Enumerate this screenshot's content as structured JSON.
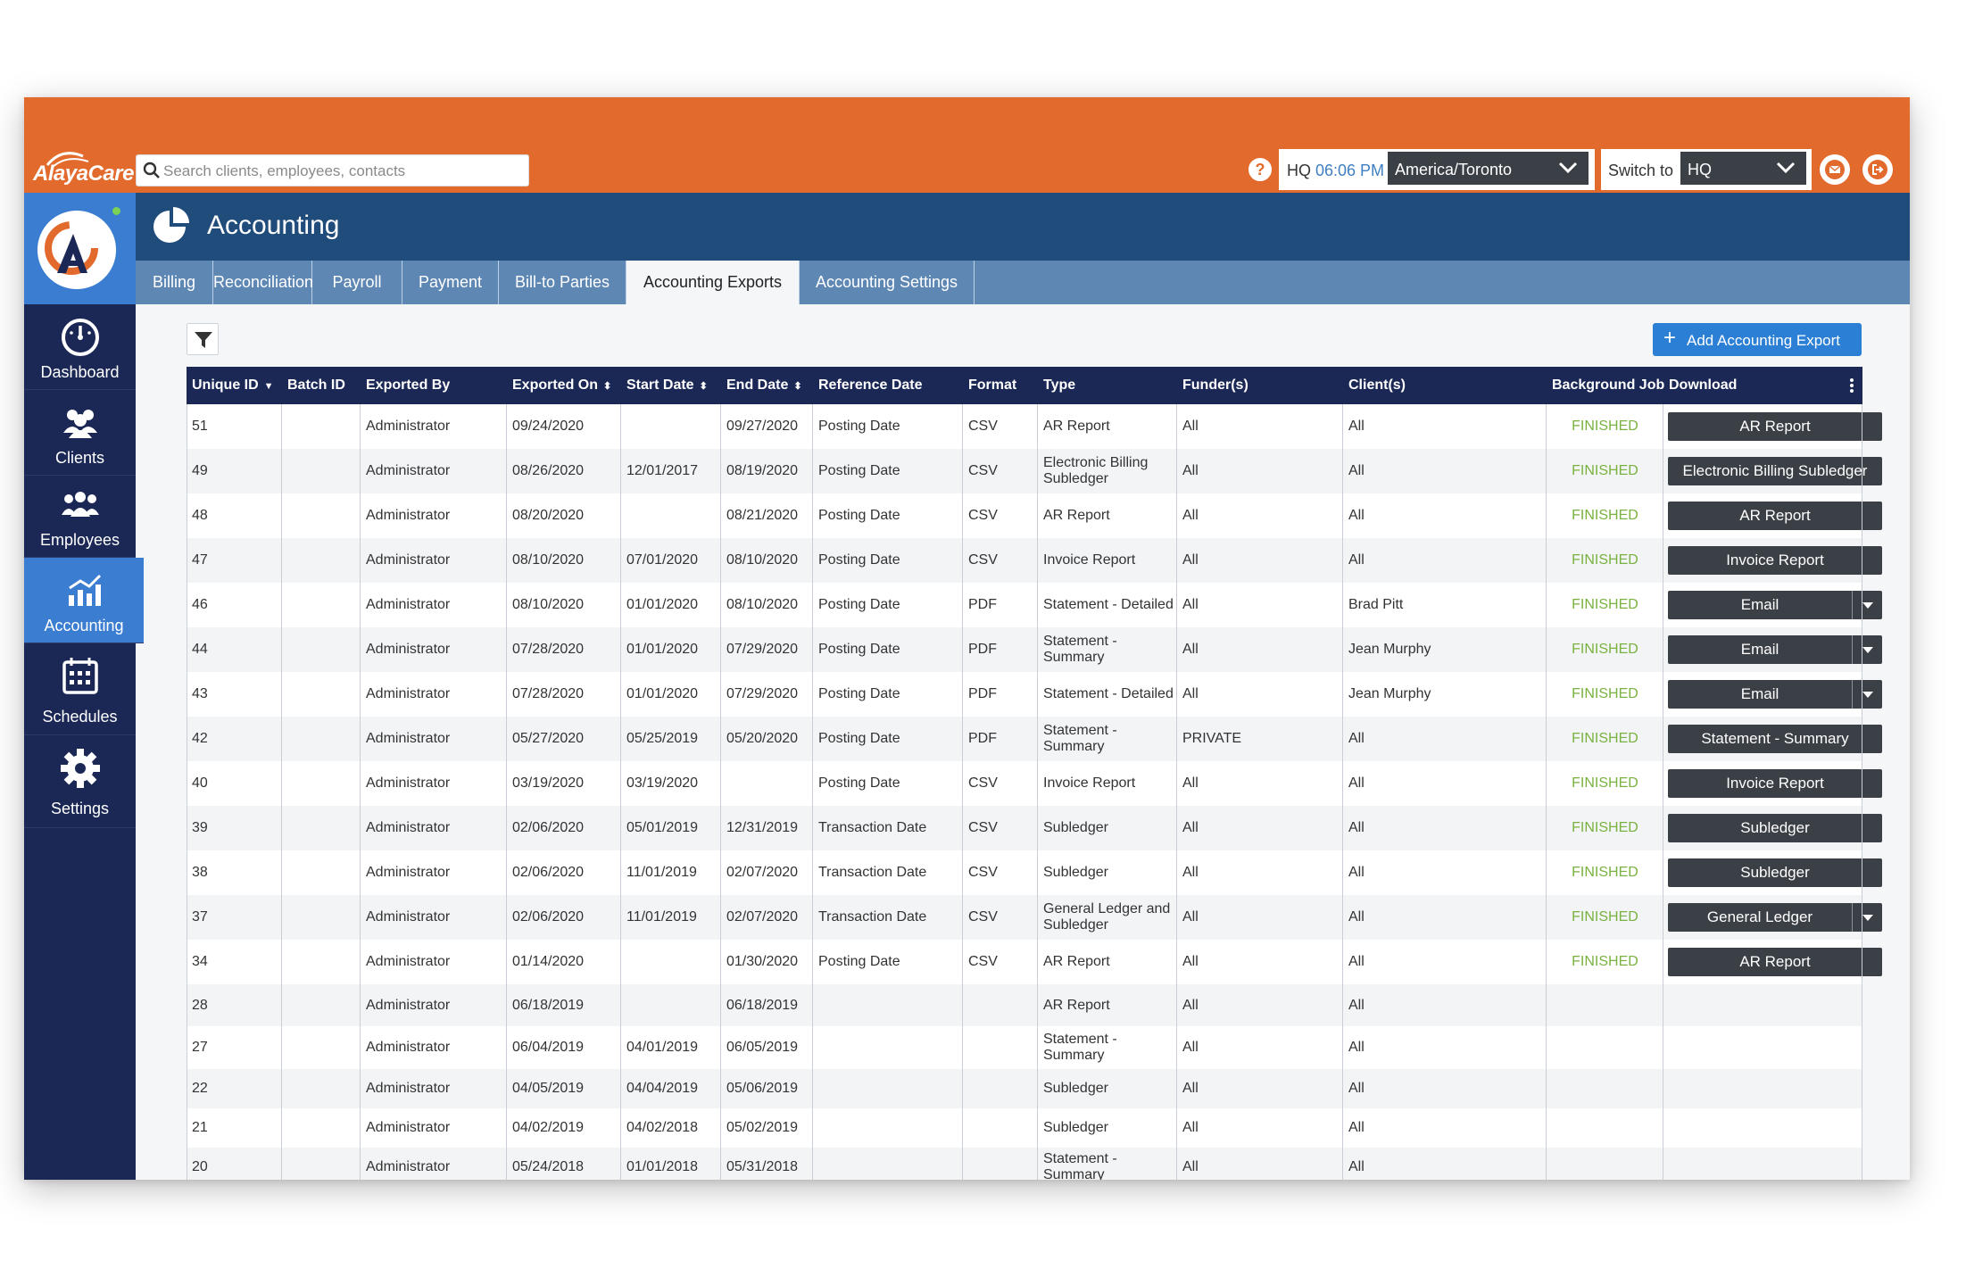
{
  "app": {
    "logo_text": "AlayaCare",
    "search_placeholder": "Search clients, employees, contacts"
  },
  "topbar": {
    "help_label": "?",
    "hq_label": "HQ",
    "time": "06:06 PM",
    "timezone": "America/Toronto",
    "switch_label": "Switch to",
    "switch_value": "HQ"
  },
  "sidebar": {
    "items": [
      {
        "label": "Dashboard",
        "icon": "gauge-icon"
      },
      {
        "label": "Clients",
        "icon": "clients-icon"
      },
      {
        "label": "Employees",
        "icon": "employees-icon"
      },
      {
        "label": "Accounting",
        "icon": "chart-icon",
        "active": true
      },
      {
        "label": "Schedules",
        "icon": "calendar-icon"
      },
      {
        "label": "Settings",
        "icon": "gear-icon"
      }
    ]
  },
  "header": {
    "title": "Accounting",
    "icon": "pie-chart-icon"
  },
  "tabs": [
    {
      "label": "Billing"
    },
    {
      "label": "Reconciliation"
    },
    {
      "label": "Payroll"
    },
    {
      "label": "Payment"
    },
    {
      "label": "Bill-to Parties"
    },
    {
      "label": "Accounting Exports",
      "active": true
    },
    {
      "label": "Accounting Settings"
    }
  ],
  "toolbar": {
    "add_label": "Add Accounting Export"
  },
  "table": {
    "columns": [
      {
        "label": "Unique ID",
        "sort": "▼"
      },
      {
        "label": "Batch ID"
      },
      {
        "label": "Exported By"
      },
      {
        "label": "Exported On",
        "sort": "⬍"
      },
      {
        "label": "Start Date",
        "sort": "⬍"
      },
      {
        "label": "End Date",
        "sort": "⬍"
      },
      {
        "label": "Reference Date"
      },
      {
        "label": "Format"
      },
      {
        "label": "Type"
      },
      {
        "label": "Funder(s)"
      },
      {
        "label": "Client(s)"
      },
      {
        "label": "Background Job"
      },
      {
        "label": "Download"
      }
    ],
    "rows": [
      {
        "id": "51",
        "batch": "",
        "by": "Administrator",
        "on": "09/24/2020",
        "start": "",
        "end": "09/27/2020",
        "ref": "Posting Date",
        "format": "CSV",
        "type": "AR Report",
        "funders": "All",
        "clients": "All",
        "status": "FINISHED",
        "download": "AR Report",
        "split": false
      },
      {
        "id": "49",
        "batch": "",
        "by": "Administrator",
        "on": "08/26/2020",
        "start": "12/01/2017",
        "end": "08/19/2020",
        "ref": "Posting Date",
        "format": "CSV",
        "type": "Electronic Billing Subledger",
        "funders": "All",
        "clients": "All",
        "status": "FINISHED",
        "download": "Electronic Billing Subledger",
        "split": false
      },
      {
        "id": "48",
        "batch": "",
        "by": "Administrator",
        "on": "08/20/2020",
        "start": "",
        "end": "08/21/2020",
        "ref": "Posting Date",
        "format": "CSV",
        "type": "AR Report",
        "funders": "All",
        "clients": "All",
        "status": "FINISHED",
        "download": "AR Report",
        "split": false
      },
      {
        "id": "47",
        "batch": "",
        "by": "Administrator",
        "on": "08/10/2020",
        "start": "07/01/2020",
        "end": "08/10/2020",
        "ref": "Posting Date",
        "format": "CSV",
        "type": "Invoice Report",
        "funders": "All",
        "clients": "All",
        "status": "FINISHED",
        "download": "Invoice Report",
        "split": false
      },
      {
        "id": "46",
        "batch": "",
        "by": "Administrator",
        "on": "08/10/2020",
        "start": "01/01/2020",
        "end": "08/10/2020",
        "ref": "Posting Date",
        "format": "PDF",
        "type": "Statement - Detailed",
        "funders": "All",
        "clients": "Brad Pitt",
        "status": "FINISHED",
        "download": "Email",
        "split": true
      },
      {
        "id": "44",
        "batch": "",
        "by": "Administrator",
        "on": "07/28/2020",
        "start": "01/01/2020",
        "end": "07/29/2020",
        "ref": "Posting Date",
        "format": "PDF",
        "type": "Statement - Summary",
        "funders": "All",
        "clients": "Jean Murphy",
        "status": "FINISHED",
        "download": "Email",
        "split": true
      },
      {
        "id": "43",
        "batch": "",
        "by": "Administrator",
        "on": "07/28/2020",
        "start": "01/01/2020",
        "end": "07/29/2020",
        "ref": "Posting Date",
        "format": "PDF",
        "type": "Statement - Detailed",
        "funders": "All",
        "clients": "Jean Murphy",
        "status": "FINISHED",
        "download": "Email",
        "split": true
      },
      {
        "id": "42",
        "batch": "",
        "by": "Administrator",
        "on": "05/27/2020",
        "start": "05/25/2019",
        "end": "05/20/2020",
        "ref": "Posting Date",
        "format": "PDF",
        "type": "Statement - Summary",
        "funders": "PRIVATE",
        "clients": "All",
        "status": "FINISHED",
        "download": "Statement - Summary",
        "split": false
      },
      {
        "id": "40",
        "batch": "",
        "by": "Administrator",
        "on": "03/19/2020",
        "start": "03/19/2020",
        "end": "",
        "ref": "Posting Date",
        "format": "CSV",
        "type": "Invoice Report",
        "funders": "All",
        "clients": "All",
        "status": "FINISHED",
        "download": "Invoice Report",
        "split": false
      },
      {
        "id": "39",
        "batch": "",
        "by": "Administrator",
        "on": "02/06/2020",
        "start": "05/01/2019",
        "end": "12/31/2019",
        "ref": "Transaction Date",
        "format": "CSV",
        "type": "Subledger",
        "funders": "All",
        "clients": "All",
        "status": "FINISHED",
        "download": "Subledger",
        "split": false
      },
      {
        "id": "38",
        "batch": "",
        "by": "Administrator",
        "on": "02/06/2020",
        "start": "11/01/2019",
        "end": "02/07/2020",
        "ref": "Transaction Date",
        "format": "CSV",
        "type": "Subledger",
        "funders": "All",
        "clients": "All",
        "status": "FINISHED",
        "download": "Subledger",
        "split": false
      },
      {
        "id": "37",
        "batch": "",
        "by": "Administrator",
        "on": "02/06/2020",
        "start": "11/01/2019",
        "end": "02/07/2020",
        "ref": "Transaction Date",
        "format": "CSV",
        "type": "General Ledger and Subledger",
        "funders": "All",
        "clients": "All",
        "status": "FINISHED",
        "download": "General Ledger",
        "split": true
      },
      {
        "id": "34",
        "batch": "",
        "by": "Administrator",
        "on": "01/14/2020",
        "start": "",
        "end": "01/30/2020",
        "ref": "Posting Date",
        "format": "CSV",
        "type": "AR Report",
        "funders": "All",
        "clients": "All",
        "status": "FINISHED",
        "download": "AR Report",
        "split": false
      },
      {
        "id": "28",
        "batch": "",
        "by": "Administrator",
        "on": "06/18/2019",
        "start": "",
        "end": "06/18/2019",
        "ref": "",
        "format": "",
        "type": "AR Report",
        "funders": "All",
        "clients": "All",
        "status": "",
        "download": "",
        "split": false
      },
      {
        "id": "27",
        "batch": "",
        "by": "Administrator",
        "on": "06/04/2019",
        "start": "04/01/2019",
        "end": "06/05/2019",
        "ref": "",
        "format": "",
        "type": "Statement - Summary",
        "funders": "All",
        "clients": "All",
        "status": "",
        "download": "",
        "split": false
      },
      {
        "id": "22",
        "batch": "",
        "by": "Administrator",
        "on": "04/05/2019",
        "start": "04/04/2019",
        "end": "05/06/2019",
        "ref": "",
        "format": "",
        "type": "Subledger",
        "funders": "All",
        "clients": "All",
        "status": "",
        "download": "",
        "split": false
      },
      {
        "id": "21",
        "batch": "",
        "by": "Administrator",
        "on": "04/02/2019",
        "start": "04/02/2018",
        "end": "05/02/2019",
        "ref": "",
        "format": "",
        "type": "Subledger",
        "funders": "All",
        "clients": "All",
        "status": "",
        "download": "",
        "split": false
      },
      {
        "id": "20",
        "batch": "",
        "by": "Administrator",
        "on": "05/24/2018",
        "start": "01/01/2018",
        "end": "05/31/2018",
        "ref": "",
        "format": "",
        "type": "Statement - Summary",
        "funders": "All",
        "clients": "All",
        "status": "",
        "download": "",
        "split": false
      }
    ]
  },
  "colors": {
    "topbar": "#e36a2d",
    "sidebar": "#1b2855",
    "header": "#1f4c7b",
    "tabs": "#5e87b4",
    "accent": "#2b80d6",
    "status_finished": "#79b23f",
    "download_button": "#3b3f46"
  }
}
